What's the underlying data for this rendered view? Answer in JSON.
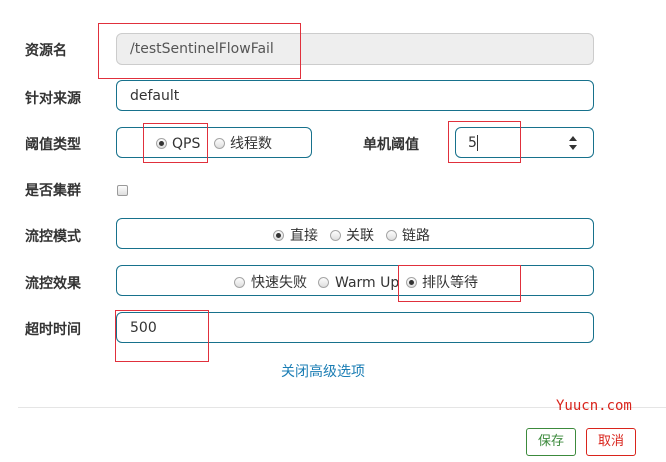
{
  "form": {
    "resource_name": {
      "label": "资源名",
      "value": "/testSentinelFlowFail"
    },
    "limit_app": {
      "label": "针对来源",
      "value": "default"
    },
    "threshold_type": {
      "label": "阈值类型",
      "options": [
        "QPS",
        "线程数"
      ],
      "selected": "QPS"
    },
    "threshold_count": {
      "label": "单机阈值",
      "value": "5"
    },
    "cluster_mode": {
      "label": "是否集群",
      "checked": false
    },
    "flow_mode": {
      "label": "流控模式",
      "options": [
        "直接",
        "关联",
        "链路"
      ],
      "selected": "直接"
    },
    "flow_effect": {
      "label": "流控效果",
      "options": [
        "快速失败",
        "Warm Up",
        "排队等待"
      ],
      "selected": "排队等待"
    },
    "timeout": {
      "label": "超时时间",
      "value": "500"
    },
    "advanced_toggle": "关闭高级选项"
  },
  "footer": {
    "save_label": "保存",
    "cancel_label": "取消"
  },
  "watermark": "Yuucn.com",
  "colors": {
    "accent": "#17718c",
    "link": "#1a7db4",
    "save": "#3c8a3c",
    "cancel": "#d9241c",
    "highlight": "#e0303c"
  }
}
